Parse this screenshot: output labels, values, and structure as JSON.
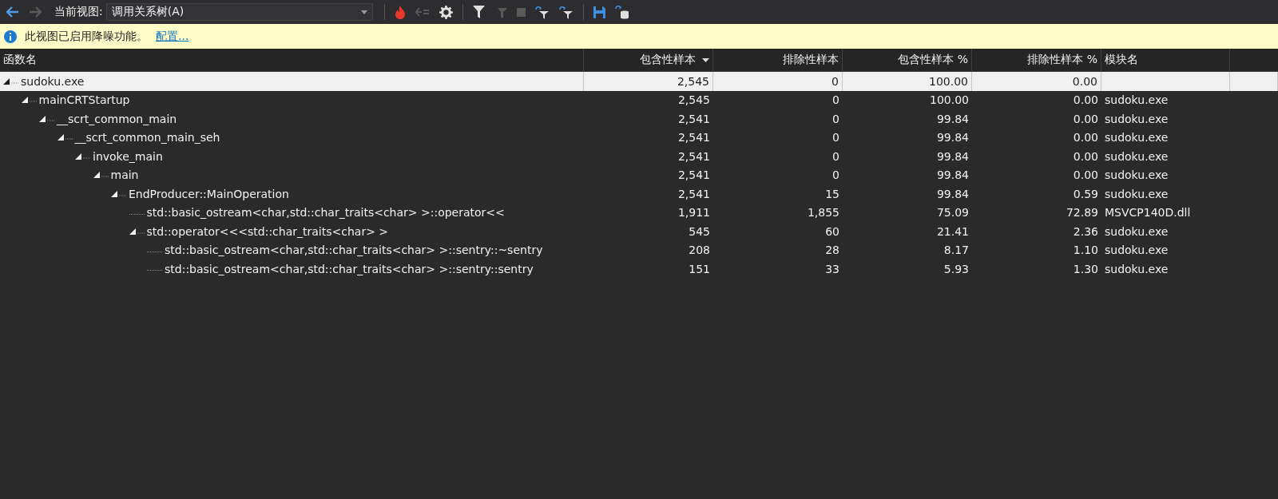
{
  "toolbar": {
    "back_enabled": true,
    "forward_enabled": false,
    "view_label": "当前视图:",
    "view_value": "调用关系树(A)",
    "buttons": [
      {
        "kind": "flame",
        "disabled": false
      },
      {
        "kind": "arrows",
        "disabled": true
      },
      {
        "kind": "gear",
        "disabled": false
      },
      {
        "kind": "filter",
        "disabled": false
      },
      {
        "kind": "filter-arrow",
        "disabled": true
      },
      {
        "kind": "stop",
        "disabled": true
      },
      {
        "kind": "link-filter",
        "disabled": false
      },
      {
        "kind": "link-filter",
        "disabled": false
      },
      {
        "kind": "save",
        "disabled": false
      },
      {
        "kind": "database",
        "disabled": false
      }
    ]
  },
  "info_bar": {
    "message": "此视图已启用降噪功能。",
    "link": "配置..."
  },
  "table": {
    "columns": [
      {
        "label": "函数名",
        "sorted": false
      },
      {
        "label": "包含性样本",
        "sorted": true
      },
      {
        "label": "排除性样本",
        "sorted": false
      },
      {
        "label": "包含性样本 %",
        "sorted": false
      },
      {
        "label": "排除性样本 %",
        "sorted": false
      },
      {
        "label": "模块名",
        "sorted": false
      }
    ],
    "rows": [
      {
        "name": "sudoku.exe",
        "inclusive": "2,545",
        "exclusive": "0",
        "inclusive_pct": "100.00",
        "exclusive_pct": "0.00",
        "expanded": true,
        "selected": true,
        "children": [
          {
            "name": "mainCRTStartup",
            "inclusive": "2,545",
            "exclusive": "0",
            "inclusive_pct": "100.00",
            "exclusive_pct": "0.00",
            "module": "sudoku.exe",
            "expanded": true,
            "selected": false,
            "children": [
              {
                "name": "__scrt_common_main",
                "inclusive": "2,541",
                "exclusive": "0",
                "inclusive_pct": "99.84",
                "exclusive_pct": "0.00",
                "module": "sudoku.exe",
                "expanded": true,
                "selected": false,
                "children": [
                  {
                    "name": "__scrt_common_main_seh",
                    "inclusive": "2,541",
                    "exclusive": "0",
                    "inclusive_pct": "99.84",
                    "exclusive_pct": "0.00",
                    "module": "sudoku.exe",
                    "expanded": true,
                    "selected": false,
                    "children": [
                      {
                        "name": "invoke_main",
                        "inclusive": "2,541",
                        "exclusive": "0",
                        "inclusive_pct": "99.84",
                        "exclusive_pct": "0.00",
                        "module": "sudoku.exe",
                        "expanded": true,
                        "selected": false,
                        "children": [
                          {
                            "name": "main",
                            "inclusive": "2,541",
                            "exclusive": "0",
                            "inclusive_pct": "99.84",
                            "exclusive_pct": "0.00",
                            "module": "sudoku.exe",
                            "expanded": true,
                            "selected": false,
                            "children": [
                              {
                                "name": "EndProducer::MainOperation",
                                "inclusive": "2,541",
                                "exclusive": "15",
                                "inclusive_pct": "99.84",
                                "exclusive_pct": "0.59",
                                "module": "sudoku.exe",
                                "expanded": true,
                                "selected": false,
                                "children": [
                                  {
                                    "name": "std::basic_ostream<char,std::char_traits<char> >::operator<<",
                                    "inclusive": "1,911",
                                    "exclusive": "1,855",
                                    "inclusive_pct": "75.09",
                                    "exclusive_pct": "72.89",
                                    "module": "MSVCP140D.dll",
                                    "selected": false
                                  },
                                  {
                                    "name": "std::operator<<<std::char_traits<char> >",
                                    "inclusive": "545",
                                    "exclusive": "60",
                                    "inclusive_pct": "21.41",
                                    "exclusive_pct": "2.36",
                                    "module": "sudoku.exe",
                                    "expanded": true,
                                    "selected": false,
                                    "children": [
                                      {
                                        "name": "std::basic_ostream<char,std::char_traits<char> >::sentry::~sentry",
                                        "inclusive": "208",
                                        "exclusive": "28",
                                        "inclusive_pct": "8.17",
                                        "exclusive_pct": "1.10",
                                        "module": "sudoku.exe",
                                        "selected": false
                                      },
                                      {
                                        "name": "std::basic_ostream<char,std::char_traits<char> >::sentry::sentry",
                                        "inclusive": "151",
                                        "exclusive": "33",
                                        "inclusive_pct": "5.93",
                                        "exclusive_pct": "1.30",
                                        "module": "sudoku.exe",
                                        "selected": false
                                      }
                                    ]
                                  }
                                ]
                              }
                            ]
                          }
                        ]
                      }
                    ]
                  }
                ]
              }
            ]
          }
        ]
      }
    ]
  }
}
